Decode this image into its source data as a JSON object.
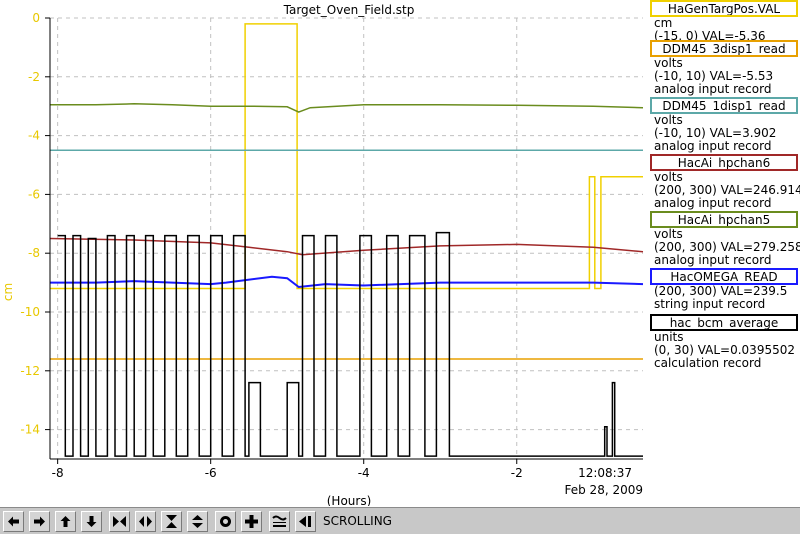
{
  "chart_data": {
    "type": "line",
    "title": "Target_Oven_Field.stp",
    "ylabel": "cm",
    "xlabel": "(Hours)",
    "xlim": [
      -8.1,
      -0.35
    ],
    "ylim": [
      -15,
      0
    ],
    "x_ticks": [
      "-8",
      "-6",
      "-4",
      "-2"
    ],
    "y_ticks": [
      "0",
      "-2",
      "-4",
      "-6",
      "-8",
      "-10",
      "-12",
      "-14"
    ],
    "time_label": "12:08:37",
    "date_label": "Feb 28, 2009",
    "grid": true,
    "series": [
      {
        "name": "HaGenTargPos.VAL",
        "color": "#f0d000",
        "x": [
          -8.1,
          -5.55,
          -5.55,
          -4.87,
          -4.87,
          -1.05,
          -1.05,
          -0.98,
          -0.98,
          -0.9,
          -0.9,
          -0.35
        ],
        "y": [
          -9.2,
          -9.2,
          -0.2,
          -0.2,
          -9.2,
          -9.2,
          -5.4,
          -5.4,
          -9.2,
          -9.2,
          -5.4,
          -5.4
        ]
      },
      {
        "name": "DDM45_3disp1_read",
        "color": "#e8a000",
        "x": [
          -8.1,
          -0.35
        ],
        "y": [
          -11.6,
          -11.6
        ]
      },
      {
        "name": "DDM45_1disp1_read",
        "color": "#5ca8a8",
        "x": [
          -8.1,
          -0.35
        ],
        "y": [
          -4.5,
          -4.5
        ]
      },
      {
        "name": "HacAi_hpchan6",
        "color": "#a02828",
        "x": [
          -8.1,
          -7.0,
          -6.0,
          -5.5,
          -5.0,
          -4.8,
          -4.0,
          -3.0,
          -2.0,
          -1.0,
          -0.35
        ],
        "y": [
          -7.5,
          -7.55,
          -7.65,
          -7.8,
          -7.95,
          -8.05,
          -7.9,
          -7.75,
          -7.7,
          -7.8,
          -7.95
        ]
      },
      {
        "name": "HacAi_hpchan5",
        "color": "#6a8c1e",
        "x": [
          -8.1,
          -7.5,
          -7.0,
          -6.5,
          -6.0,
          -5.5,
          -5.0,
          -4.85,
          -4.7,
          -4.0,
          -3.0,
          -2.0,
          -1.0,
          -0.35
        ],
        "y": [
          -2.95,
          -2.95,
          -2.92,
          -2.95,
          -3.0,
          -3.0,
          -3.02,
          -3.2,
          -3.05,
          -2.95,
          -2.95,
          -2.97,
          -3.0,
          -3.05
        ]
      },
      {
        "name": "HacOMEGA_READ",
        "color": "#1a1aff",
        "x": [
          -8.1,
          -7.5,
          -7.0,
          -6.5,
          -6.0,
          -5.8,
          -5.2,
          -5.0,
          -4.85,
          -4.5,
          -4.0,
          -3.0,
          -2.0,
          -1.0,
          -0.35
        ],
        "y": [
          -9.0,
          -9.0,
          -8.95,
          -9.0,
          -9.05,
          -9.0,
          -8.8,
          -8.85,
          -9.15,
          -9.05,
          -9.1,
          -9.0,
          -9.0,
          -9.0,
          -9.05
        ]
      },
      {
        "name": "hac_bcm_average",
        "color": "#000000",
        "x": [
          -8.0,
          -7.9,
          -7.9,
          -7.8,
          -7.8,
          -7.7,
          -7.7,
          -7.6,
          -7.6,
          -7.5,
          -7.5,
          -7.35,
          -7.35,
          -7.25,
          -7.25,
          -7.1,
          -7.1,
          -7.0,
          -7.0,
          -6.85,
          -6.85,
          -6.75,
          -6.75,
          -6.6,
          -6.6,
          -6.45,
          -6.45,
          -6.3,
          -6.3,
          -6.15,
          -6.15,
          -6.0,
          -6.0,
          -5.85,
          -5.85,
          -5.7,
          -5.7,
          -5.55,
          -5.55,
          -5.5,
          -5.5,
          -5.35,
          -5.35,
          -5.0,
          -5.0,
          -4.85,
          -4.85,
          -4.8,
          -4.8,
          -4.65,
          -4.65,
          -4.5,
          -4.5,
          -4.35,
          -4.35,
          -4.15,
          -4.15,
          -4.05,
          -4.05,
          -3.9,
          -3.9,
          -3.7,
          -3.7,
          -3.55,
          -3.55,
          -3.4,
          -3.4,
          -3.2,
          -3.2,
          -3.05,
          -3.05,
          -2.88,
          -2.88,
          -2.85,
          -2.85,
          -0.85,
          -0.85,
          -0.82,
          -0.82,
          -0.75,
          -0.75,
          -0.72,
          -0.72,
          -0.68,
          -0.68,
          -0.35
        ],
        "y": [
          -7.4,
          -7.4,
          -14.9,
          -14.9,
          -7.4,
          -7.4,
          -14.9,
          -14.9,
          -7.5,
          -7.5,
          -14.9,
          -14.9,
          -7.4,
          -7.4,
          -14.9,
          -14.9,
          -7.4,
          -7.4,
          -14.9,
          -14.9,
          -7.4,
          -7.4,
          -14.9,
          -14.9,
          -7.4,
          -7.4,
          -14.9,
          -14.9,
          -7.4,
          -7.4,
          -14.9,
          -14.9,
          -7.4,
          -7.4,
          -14.9,
          -14.9,
          -7.4,
          -7.4,
          -14.9,
          -14.9,
          -12.4,
          -12.4,
          -14.9,
          -14.9,
          -12.4,
          -12.4,
          -14.9,
          -14.9,
          -7.4,
          -7.4,
          -14.9,
          -14.9,
          -7.4,
          -7.4,
          -14.9,
          -14.9,
          -14.9,
          -14.9,
          -7.4,
          -7.4,
          -14.9,
          -14.9,
          -7.4,
          -7.4,
          -14.9,
          -14.9,
          -7.4,
          -7.4,
          -14.9,
          -14.9,
          -7.3,
          -7.3,
          -14.9,
          -14.9,
          -14.9,
          -14.9,
          -13.9,
          -13.9,
          -14.9,
          -14.9,
          -12.4,
          -12.4,
          -14.9,
          -14.9,
          -14.9,
          -14.9
        ]
      }
    ]
  },
  "legend": [
    {
      "name": "HaGenTargPos.VAL",
      "color": "#f0d000",
      "lines": [
        "cm",
        "(-15, 0) VAL=-5.36"
      ]
    },
    {
      "name": "DDM45_3disp1_read",
      "color": "#e8a000",
      "lines": [
        "volts",
        "(-10, 10) VAL=-5.53",
        "analog input record"
      ]
    },
    {
      "name": "DDM45_1disp1_read",
      "color": "#5ca8a8",
      "lines": [
        "volts",
        "(-10, 10) VAL=3.902",
        "analog input record"
      ]
    },
    {
      "name": "HacAi_hpchan6",
      "color": "#a02828",
      "lines": [
        "volts",
        "(200, 300) VAL=246.914",
        "analog input record"
      ]
    },
    {
      "name": "HacAi_hpchan5",
      "color": "#6a8c1e",
      "lines": [
        "volts",
        "(200, 300) VAL=279.258",
        "analog input record"
      ]
    },
    {
      "name": "HacOMEGA_READ",
      "color": "#1a1aff",
      "lines": [
        "(200, 300) VAL=239.5",
        "string input record"
      ]
    },
    {
      "name": "hac_bcm_average",
      "color": "#000000",
      "lines": [
        "units",
        "(0, 30) VAL=0.0395502",
        "calculation record"
      ]
    }
  ],
  "toolbar": {
    "buttons": [
      {
        "name": "scroll-left-button",
        "icon": "arrow-left-icon"
      },
      {
        "name": "scroll-right-button",
        "icon": "arrow-right-icon"
      },
      {
        "name": "scroll-up-button",
        "icon": "arrow-up-icon"
      },
      {
        "name": "scroll-down-button",
        "icon": "arrow-down-icon"
      },
      {
        "name": "zoom-in-x-button",
        "icon": "zoom-in-x-icon"
      },
      {
        "name": "zoom-out-x-button",
        "icon": "zoom-out-x-icon"
      },
      {
        "name": "zoom-in-y-button",
        "icon": "zoom-in-y-icon"
      },
      {
        "name": "zoom-out-y-button",
        "icon": "zoom-out-y-icon"
      },
      {
        "name": "reset-button",
        "icon": "circle-icon"
      },
      {
        "name": "add-button",
        "icon": "plus-icon"
      },
      {
        "name": "autoscale-button",
        "icon": "autoscale-icon"
      },
      {
        "name": "scroll-mode-button",
        "icon": "scroll-end-icon"
      }
    ],
    "mode_label": "SCROLLING"
  }
}
